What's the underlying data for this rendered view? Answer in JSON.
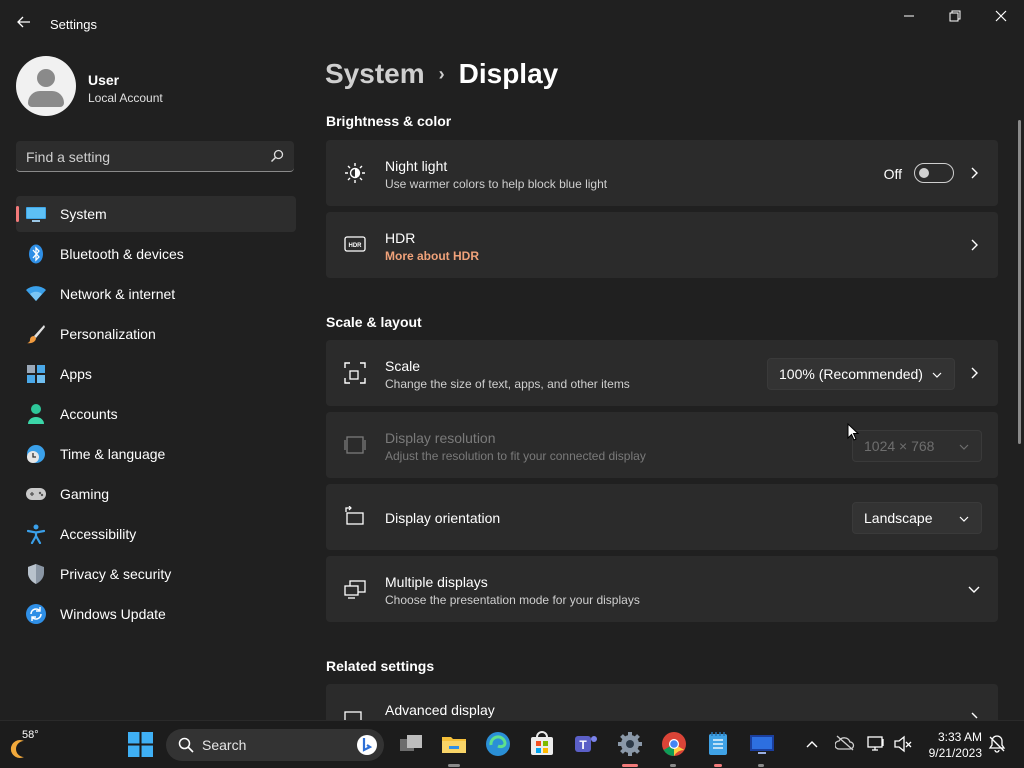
{
  "window": {
    "title": "Settings"
  },
  "user": {
    "name": "User",
    "account_type": "Local Account"
  },
  "search": {
    "placeholder": "Find a setting"
  },
  "nav": [
    {
      "label": "System",
      "icon": "monitor-icon",
      "active": true
    },
    {
      "label": "Bluetooth & devices",
      "icon": "bluetooth-icon"
    },
    {
      "label": "Network & internet",
      "icon": "wifi-icon"
    },
    {
      "label": "Personalization",
      "icon": "brush-icon"
    },
    {
      "label": "Apps",
      "icon": "apps-icon"
    },
    {
      "label": "Accounts",
      "icon": "person-icon"
    },
    {
      "label": "Time & language",
      "icon": "globe-clock-icon"
    },
    {
      "label": "Gaming",
      "icon": "gamepad-icon"
    },
    {
      "label": "Accessibility",
      "icon": "accessibility-icon"
    },
    {
      "label": "Privacy & security",
      "icon": "shield-icon"
    },
    {
      "label": "Windows Update",
      "icon": "update-icon"
    }
  ],
  "breadcrumb": {
    "parent": "System",
    "separator": "›",
    "current": "Display"
  },
  "sections": {
    "brightness": "Brightness & color",
    "scale_layout": "Scale & layout",
    "related": "Related settings"
  },
  "night_light": {
    "title": "Night light",
    "subtitle": "Use warmer colors to help block blue light",
    "state_label": "Off"
  },
  "hdr": {
    "title": "HDR",
    "link": "More about HDR"
  },
  "scale": {
    "title": "Scale",
    "subtitle": "Change the size of text, apps, and other items",
    "value": "100% (Recommended)"
  },
  "resolution": {
    "title": "Display resolution",
    "subtitle": "Adjust the resolution to fit your connected display",
    "value": "1024 × 768"
  },
  "orientation": {
    "title": "Display orientation",
    "value": "Landscape"
  },
  "multiple_displays": {
    "title": "Multiple displays",
    "subtitle": "Choose the presentation mode for your displays"
  },
  "advanced_display": {
    "title": "Advanced display"
  },
  "taskbar": {
    "weather_temp": "58°",
    "search_label": "Search",
    "time": "3:33 AM",
    "date": "9/21/2023"
  },
  "colors": {
    "accent": "#f27a7a",
    "hdr_link": "#f0a27a",
    "card": "#2b2b2b",
    "background": "#202020"
  }
}
